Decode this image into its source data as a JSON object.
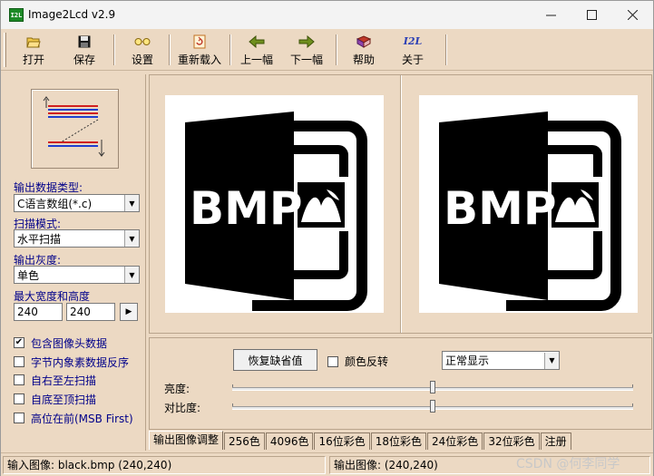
{
  "window": {
    "title": "Image2Lcd v2.9",
    "icon_text": "I2L"
  },
  "toolbar": {
    "items": [
      {
        "label": "打开",
        "icon": "folder-open-icon"
      },
      {
        "label": "保存",
        "icon": "floppy-disk-icon"
      },
      {
        "label": "设置",
        "icon": "glasses-icon"
      },
      {
        "label": "重新载入",
        "icon": "reload-icon"
      },
      {
        "label": "上一幅",
        "icon": "arrow-left-icon"
      },
      {
        "label": "下一幅",
        "icon": "arrow-right-icon"
      },
      {
        "label": "帮助",
        "icon": "help-book-icon"
      },
      {
        "label": "关于",
        "icon": "about-logo-icon"
      }
    ],
    "about_logo_text": "I2L"
  },
  "left_panel": {
    "output_type_label": "输出数据类型:",
    "output_type_value": "C语言数组(*.c)",
    "scan_mode_label": "扫描模式:",
    "scan_mode_value": "水平扫描",
    "gray_label": "输出灰度:",
    "gray_value": "单色",
    "max_size_label": "最大宽度和高度",
    "max_width": "240",
    "max_height": "240",
    "checkboxes": [
      {
        "label": "包含图像头数据",
        "checked": true
      },
      {
        "label": "字节内象素数据反序",
        "checked": false
      },
      {
        "label": "自右至左扫描",
        "checked": false
      },
      {
        "label": "自底至顶扫描",
        "checked": false
      },
      {
        "label": "高位在前(MSB First)",
        "checked": false
      }
    ]
  },
  "images": {
    "text": "BMP"
  },
  "adjust": {
    "restore_label": "恢复缺省值",
    "invert_label": "颜色反转",
    "invert_checked": false,
    "display_mode": "正常显示",
    "brightness_label": "亮度:",
    "contrast_label": "对比度:",
    "brightness_value": 50,
    "contrast_value": 50
  },
  "tabs": [
    "输出图像调整",
    "256色",
    "4096色",
    "16位彩色",
    "18位彩色",
    "24位彩色",
    "32位彩色",
    "注册"
  ],
  "active_tab": 0,
  "status": {
    "input": "输入图像: black.bmp (240,240)",
    "output": "输出图像: (240,240)"
  },
  "watermark": "CSDN @何李同学",
  "colors": {
    "panel_bg": "#ecd9c3",
    "label_blue": "#00008a"
  }
}
